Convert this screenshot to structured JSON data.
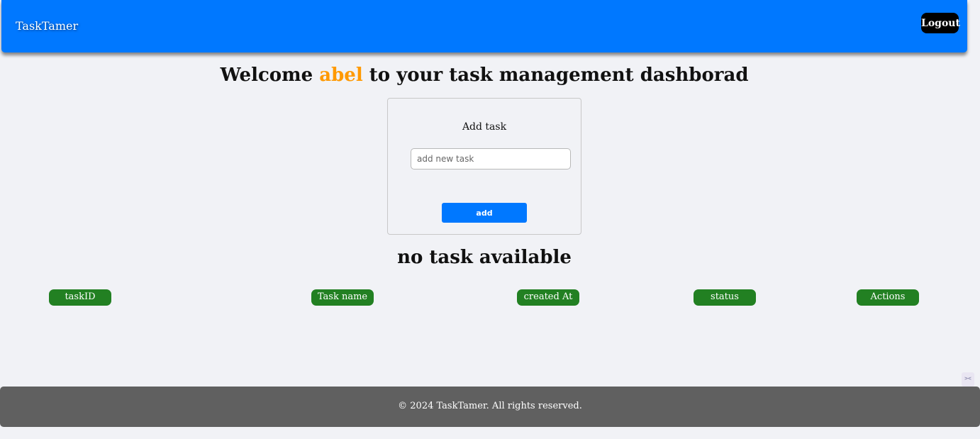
{
  "navbar": {
    "brand": "TaskTamer",
    "logout_label": "Logout"
  },
  "welcome": {
    "prefix": "Welcome",
    "username": "abel",
    "suffix": "to your task management dashborad"
  },
  "add_task": {
    "title": "Add task",
    "input_value": "",
    "input_placeholder": "add new task",
    "button_label": "add"
  },
  "tasks": {
    "empty_message": "no task available",
    "columns": [
      "taskID",
      "Task name",
      "created At",
      "status",
      "Actions"
    ],
    "rows": []
  },
  "footer": {
    "text": "© 2024 TaskTamer. All rights reserved."
  },
  "icons": {
    "corner": "collapse-arrows-icon"
  },
  "colors": {
    "primary": "#0078ff",
    "username": "#ff9900",
    "header_badge": "#228022",
    "footer_bg": "#606060",
    "logout_bg": "#000000"
  }
}
